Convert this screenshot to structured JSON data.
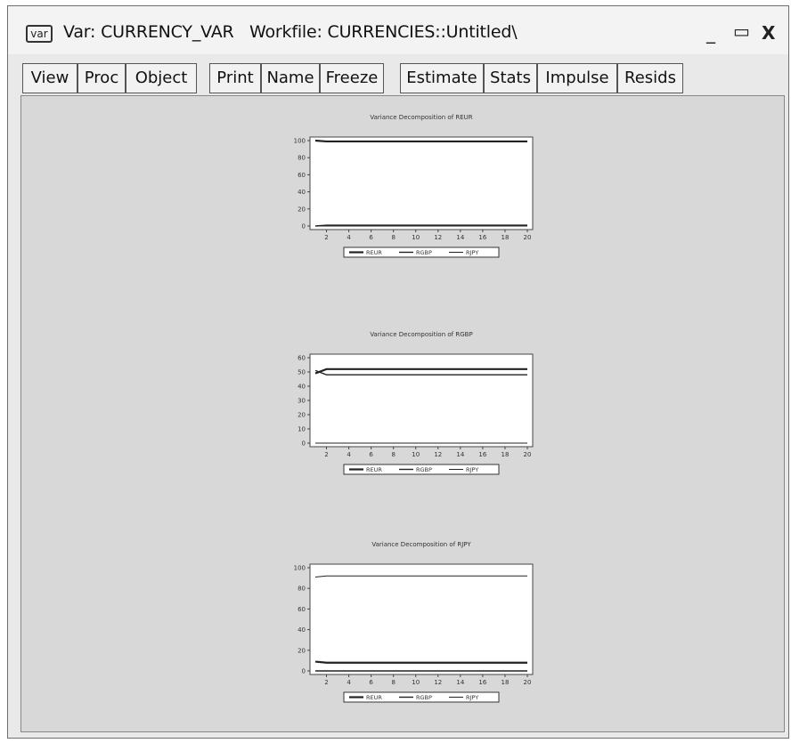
{
  "window": {
    "icon_text": "var",
    "title": "Var: CURRENCY_VAR   Workfile: CURRENCIES::Untitled\\",
    "minimize": "_",
    "maximize": "▭",
    "close": "X"
  },
  "toolbar": {
    "buttons": [
      "View",
      "Proc",
      "Object",
      "Print",
      "Name",
      "Freeze",
      "Estimate",
      "Stats",
      "Impulse",
      "Resids"
    ]
  },
  "chart_data": [
    {
      "type": "line",
      "title": "Variance Decomposition of REUR",
      "x": [
        1,
        2,
        3,
        4,
        5,
        6,
        7,
        8,
        9,
        10,
        11,
        12,
        13,
        14,
        15,
        16,
        17,
        18,
        19,
        20
      ],
      "xticks": [
        2,
        4,
        6,
        8,
        10,
        12,
        14,
        16,
        18,
        20
      ],
      "ylim": [
        0,
        100
      ],
      "yticks": [
        0,
        20,
        40,
        60,
        80,
        100
      ],
      "series": [
        {
          "name": "REUR",
          "values": [
            100,
            99,
            99,
            99,
            99,
            99,
            99,
            99,
            99,
            99,
            99,
            99,
            99,
            99,
            99,
            99,
            99,
            99,
            99,
            99
          ]
        },
        {
          "name": "RGBP",
          "values": [
            0,
            1,
            1,
            1,
            1,
            1,
            1,
            1,
            1,
            1,
            1,
            1,
            1,
            1,
            1,
            1,
            1,
            1,
            1,
            1
          ]
        },
        {
          "name": "RJPY",
          "values": [
            0,
            0,
            0,
            0,
            0,
            0,
            0,
            0,
            0,
            0,
            0,
            0,
            0,
            0,
            0,
            0,
            0,
            0,
            0,
            0
          ]
        }
      ],
      "legend": "bottom"
    },
    {
      "type": "line",
      "title": "Variance Decomposition of RGBP",
      "x": [
        1,
        2,
        3,
        4,
        5,
        6,
        7,
        8,
        9,
        10,
        11,
        12,
        13,
        14,
        15,
        16,
        17,
        18,
        19,
        20
      ],
      "xticks": [
        2,
        4,
        6,
        8,
        10,
        12,
        14,
        16,
        18,
        20
      ],
      "ylim": [
        0,
        60
      ],
      "yticks": [
        0,
        10,
        20,
        30,
        40,
        50,
        60
      ],
      "series": [
        {
          "name": "REUR",
          "values": [
            49,
            52,
            52,
            52,
            52,
            52,
            52,
            52,
            52,
            52,
            52,
            52,
            52,
            52,
            52,
            52,
            52,
            52,
            52,
            52
          ]
        },
        {
          "name": "RGBP",
          "values": [
            51,
            48,
            48,
            48,
            48,
            48,
            48,
            48,
            48,
            48,
            48,
            48,
            48,
            48,
            48,
            48,
            48,
            48,
            48,
            48
          ]
        },
        {
          "name": "RJPY",
          "values": [
            0,
            0,
            0,
            0,
            0,
            0,
            0,
            0,
            0,
            0,
            0,
            0,
            0,
            0,
            0,
            0,
            0,
            0,
            0,
            0
          ]
        }
      ],
      "legend": "bottom"
    },
    {
      "type": "line",
      "title": "Variance Decomposition of RJPY",
      "x": [
        1,
        2,
        3,
        4,
        5,
        6,
        7,
        8,
        9,
        10,
        11,
        12,
        13,
        14,
        15,
        16,
        17,
        18,
        19,
        20
      ],
      "xticks": [
        2,
        4,
        6,
        8,
        10,
        12,
        14,
        16,
        18,
        20
      ],
      "ylim": [
        0,
        100
      ],
      "yticks": [
        0,
        20,
        40,
        60,
        80,
        100
      ],
      "series": [
        {
          "name": "REUR",
          "values": [
            9,
            8,
            8,
            8,
            8,
            8,
            8,
            8,
            8,
            8,
            8,
            8,
            8,
            8,
            8,
            8,
            8,
            8,
            8,
            8
          ]
        },
        {
          "name": "RGBP",
          "values": [
            0,
            0,
            0,
            0,
            0,
            0,
            0,
            0,
            0,
            0,
            0,
            0,
            0,
            0,
            0,
            0,
            0,
            0,
            0,
            0
          ]
        },
        {
          "name": "RJPY",
          "values": [
            91,
            92,
            92,
            92,
            92,
            92,
            92,
            92,
            92,
            92,
            92,
            92,
            92,
            92,
            92,
            92,
            92,
            92,
            92,
            92
          ]
        }
      ],
      "legend": "bottom"
    }
  ]
}
